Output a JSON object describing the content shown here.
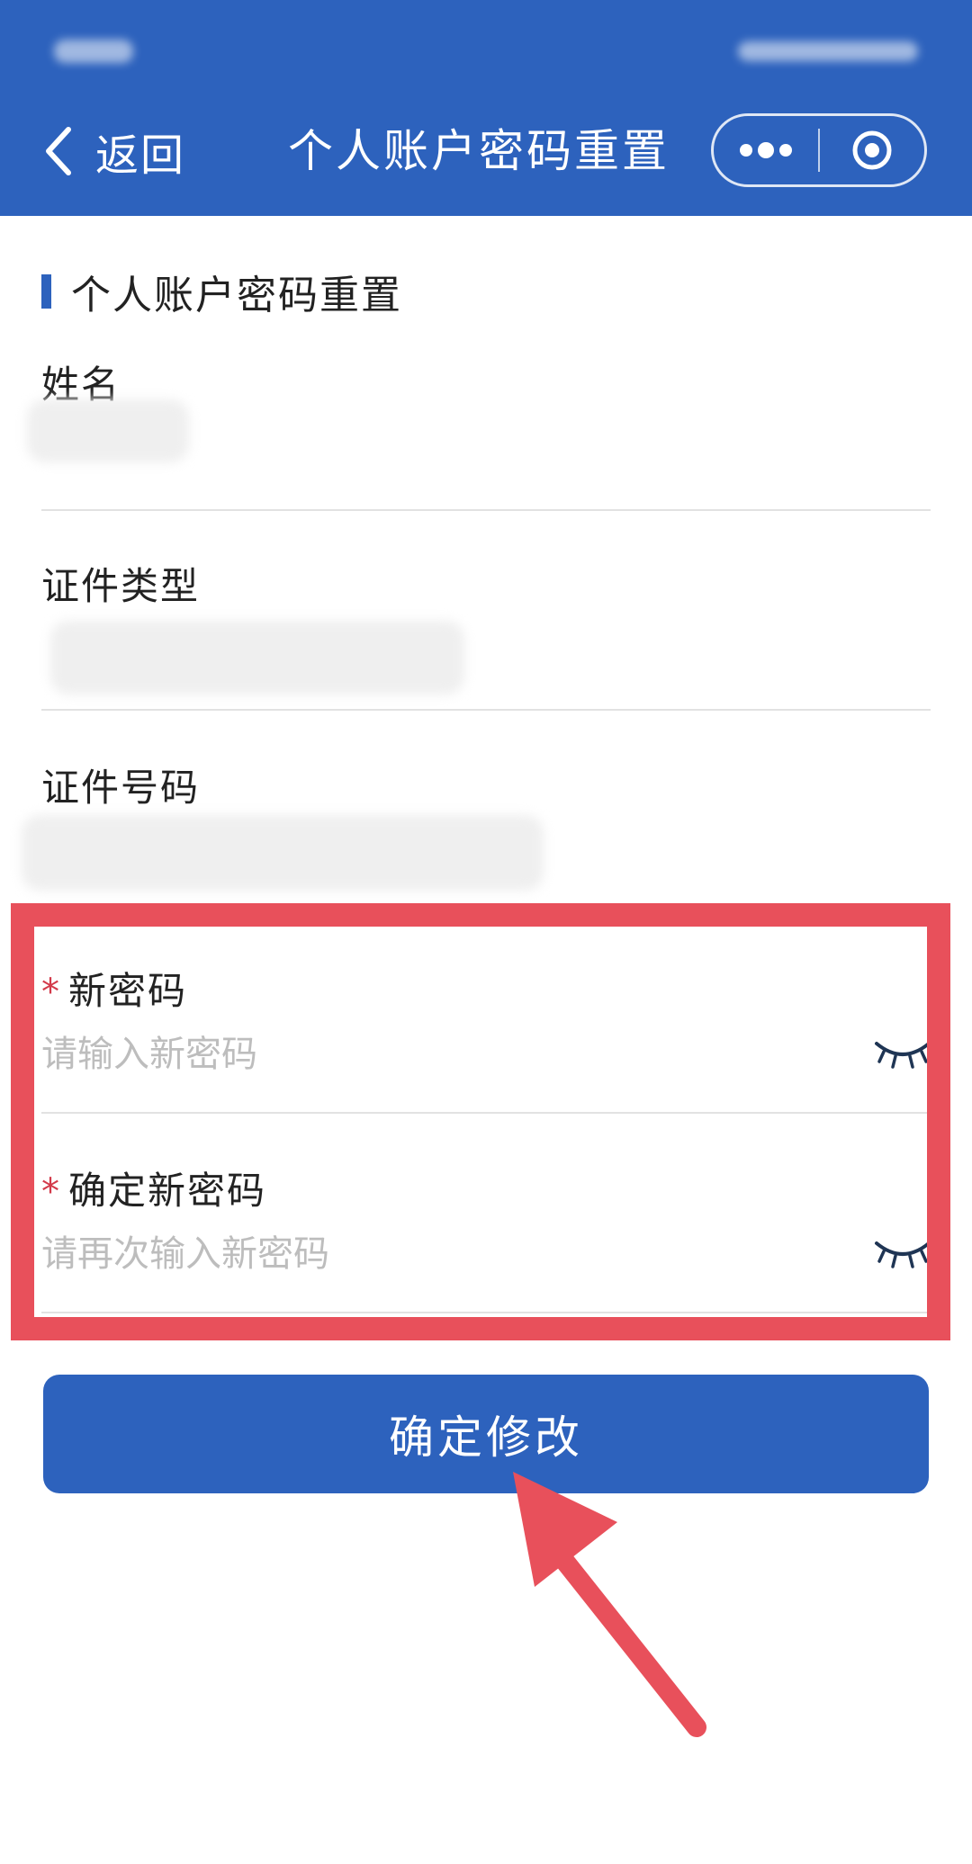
{
  "colors": {
    "brand": "#2d62bd",
    "highlight": "#e8505b"
  },
  "nav": {
    "back_label": "返回",
    "title": "个人账户密码重置",
    "back_icon": "chevron-left-icon",
    "more_icon": "more-dots-icon",
    "close_icon": "target-circle-icon"
  },
  "form": {
    "section_title": "个人账户密码重置",
    "name_label": "姓名",
    "id_type_label": "证件类型",
    "id_number_label": "证件号码",
    "new_password": {
      "required_mark": "*",
      "label": "新密码",
      "placeholder": "请输入新密码",
      "toggle_icon": "eye-closed-icon"
    },
    "confirm_password": {
      "required_mark": "*",
      "label": "确定新密码",
      "placeholder": "请再次输入新密码",
      "toggle_icon": "eye-closed-icon"
    },
    "submit_label": "确定修改"
  },
  "annotations": {
    "arrow_icon": "arrow-up-left-icon"
  }
}
